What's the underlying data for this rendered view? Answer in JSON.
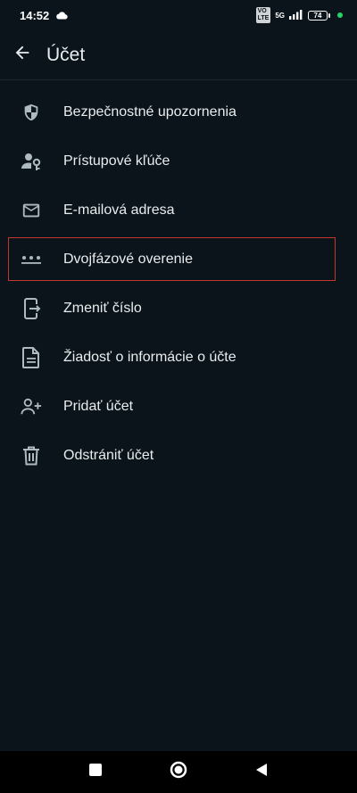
{
  "status_bar": {
    "time": "14:52",
    "volte_badge": "VoLTE",
    "network_label": "5G",
    "battery_level": "74",
    "indicator_color": "#25d366"
  },
  "header": {
    "title": "Účet",
    "back_icon": "arrow-left-icon"
  },
  "menu": {
    "items": [
      {
        "label": "Bezpečnostné upozornenia",
        "icon": "shield-icon"
      },
      {
        "label": "Prístupové kľúče",
        "icon": "person-key-icon"
      },
      {
        "label": "E-mailová adresa",
        "icon": "mail-icon"
      },
      {
        "label": "Dvojfázové overenie",
        "icon": "dots-icon"
      },
      {
        "label": "Zmeniť číslo",
        "icon": "phone-transfer-icon"
      },
      {
        "label": "Žiadosť o informácie o účte",
        "icon": "document-icon"
      },
      {
        "label": "Pridať účet",
        "icon": "add-person-icon"
      },
      {
        "label": "Odstrániť účet",
        "icon": "trash-icon"
      }
    ],
    "highlighted_index": 3,
    "highlight_color": "#c0392b"
  },
  "nav_bar": {
    "buttons": [
      "square-icon",
      "circle-icon",
      "triangle-back-icon"
    ]
  }
}
